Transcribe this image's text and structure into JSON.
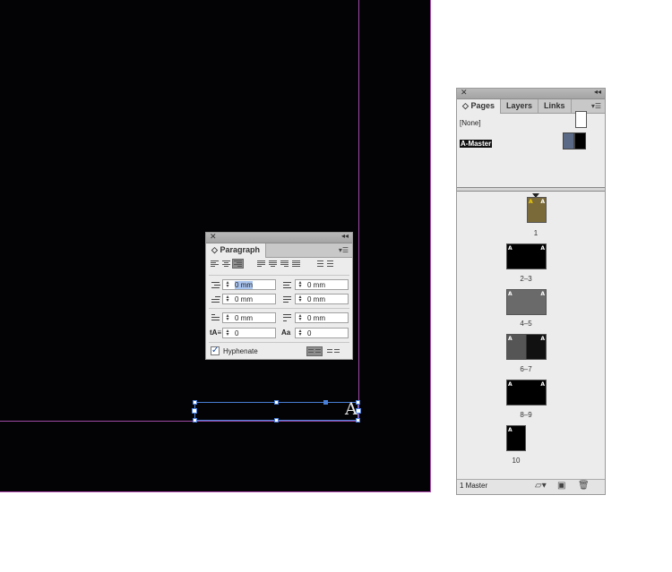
{
  "paragraph_panel": {
    "close": "✕",
    "collapse": "◂◂",
    "tab": "Paragraph",
    "tab_marker": "◇",
    "menu": "▾☰",
    "left_indent": "0 mm",
    "right_indent": "0 mm",
    "first_line_indent": "0 mm",
    "last_line_indent": "0 mm",
    "space_before": "0 mm",
    "space_after": "0 mm",
    "drop_cap_lines": "0",
    "drop_cap_chars": "0",
    "hyphenate_label": "Hyphenate",
    "hyphenate_checked": true
  },
  "pages_panel": {
    "close": "✕",
    "collapse": "◂◂",
    "tabs": [
      "Pages",
      "Layers",
      "Links"
    ],
    "tab_marker": "◇",
    "menu": "▾☰",
    "none_label": "[None]",
    "master_label": "A-Master",
    "pages": [
      {
        "label": "1"
      },
      {
        "label": "2–3"
      },
      {
        "label": "4–5"
      },
      {
        "label": "6–7"
      },
      {
        "label": "8–9"
      },
      {
        "label": "10"
      }
    ],
    "master_marker": "A",
    "footer_text": "1 Master"
  },
  "canvas": {
    "frame_character": "A"
  }
}
